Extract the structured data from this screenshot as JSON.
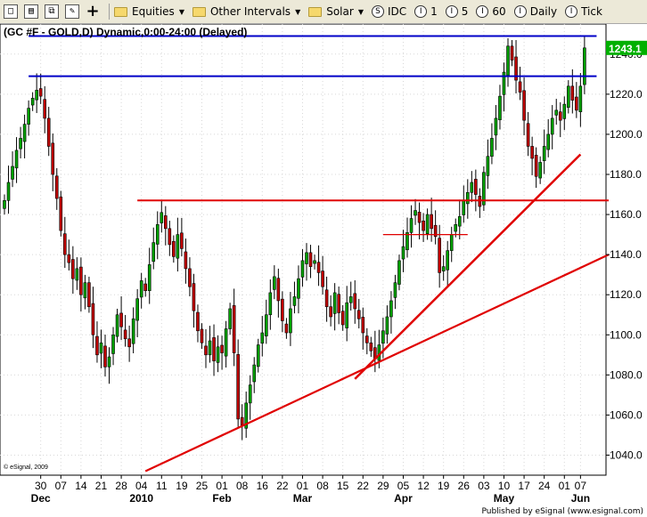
{
  "toolbar": {
    "items": [
      {
        "label": "Equities"
      },
      {
        "label": "Other Intervals"
      },
      {
        "label": "Solar"
      },
      {
        "glyph": "S",
        "label": "IDC"
      },
      {
        "glyph": "I",
        "label": "1"
      },
      {
        "glyph": "I",
        "label": "5"
      },
      {
        "glyph": "I",
        "label": "60"
      },
      {
        "glyph": "I",
        "label": "Daily"
      },
      {
        "glyph": "I",
        "label": "Tick"
      }
    ]
  },
  "copyright": "© eSignal, 2009",
  "footer": "Published by eSignal (www.esignal.com)",
  "colors": {
    "up": "#00a000",
    "down": "#c00000",
    "support": "#e00000",
    "resistance": "#0000c8",
    "price_tag": "#00b000"
  },
  "chart_data": {
    "type": "candlestick",
    "title": "(GC #F - GOLD,D) Dynamic,0:00-24:00 (Delayed)",
    "ylim": [
      1030,
      1255
    ],
    "y_ticks": [
      1040,
      1060,
      1080,
      1100,
      1120,
      1140,
      1160,
      1180,
      1200,
      1220,
      1240
    ],
    "last_price": "1243.1",
    "x_ticks": [
      {
        "i": 9,
        "label": "30"
      },
      {
        "i": 14,
        "label": "07"
      },
      {
        "i": 19,
        "label": "14"
      },
      {
        "i": 24,
        "label": "21"
      },
      {
        "i": 29,
        "label": "28"
      },
      {
        "i": 34,
        "label": "04"
      },
      {
        "i": 39,
        "label": "11"
      },
      {
        "i": 44,
        "label": "19"
      },
      {
        "i": 49,
        "label": "25"
      },
      {
        "i": 54,
        "label": "01"
      },
      {
        "i": 59,
        "label": "08"
      },
      {
        "i": 64,
        "label": "16"
      },
      {
        "i": 69,
        "label": "22"
      },
      {
        "i": 74,
        "label": "01"
      },
      {
        "i": 79,
        "label": "08"
      },
      {
        "i": 84,
        "label": "15"
      },
      {
        "i": 89,
        "label": "22"
      },
      {
        "i": 94,
        "label": "29"
      },
      {
        "i": 99,
        "label": "05"
      },
      {
        "i": 104,
        "label": "12"
      },
      {
        "i": 109,
        "label": "19"
      },
      {
        "i": 114,
        "label": "26"
      },
      {
        "i": 119,
        "label": "03"
      },
      {
        "i": 124,
        "label": "10"
      },
      {
        "i": 129,
        "label": "17"
      },
      {
        "i": 134,
        "label": "24"
      },
      {
        "i": 139,
        "label": "01"
      },
      {
        "i": 143,
        "label": "07"
      }
    ],
    "x_months": [
      {
        "i": 9,
        "label": "Dec"
      },
      {
        "i": 34,
        "label": "2010"
      },
      {
        "i": 54,
        "label": "Feb"
      },
      {
        "i": 74,
        "label": "Mar"
      },
      {
        "i": 99,
        "label": "Apr"
      },
      {
        "i": 124,
        "label": "May"
      },
      {
        "i": 143,
        "label": "Jun"
      }
    ],
    "closes": [
      1167,
      1176,
      1184,
      1192,
      1198,
      1205,
      1213,
      1218,
      1222,
      1219,
      1208,
      1194,
      1180,
      1168,
      1152,
      1140,
      1136,
      1128,
      1133,
      1120,
      1126,
      1114,
      1100,
      1090,
      1096,
      1084,
      1089,
      1100,
      1110,
      1104,
      1098,
      1094,
      1108,
      1118,
      1127,
      1122,
      1135,
      1146,
      1155,
      1161,
      1153,
      1145,
      1139,
      1150,
      1143,
      1133,
      1124,
      1112,
      1102,
      1096,
      1090,
      1097,
      1087,
      1094,
      1091,
      1103,
      1113,
      1091,
      1058,
      1055,
      1066,
      1075,
      1085,
      1095,
      1101,
      1110,
      1121,
      1129,
      1117,
      1107,
      1101,
      1113,
      1119,
      1128,
      1137,
      1141,
      1134,
      1137,
      1131,
      1124,
      1114,
      1109,
      1121,
      1111,
      1105,
      1116,
      1119,
      1113,
      1108,
      1101,
      1096,
      1092,
      1088,
      1095,
      1102,
      1109,
      1117,
      1126,
      1137,
      1144,
      1151,
      1158,
      1162,
      1156,
      1152,
      1160,
      1153,
      1149,
      1131,
      1134,
      1142,
      1150,
      1155,
      1159,
      1167,
      1171,
      1176,
      1170,
      1164,
      1181,
      1189,
      1198,
      1208,
      1219,
      1231,
      1244,
      1237,
      1227,
      1221,
      1207,
      1194,
      1188,
      1179,
      1186,
      1194,
      1200,
      1208,
      1212,
      1207,
      1215,
      1224,
      1217,
      1212,
      1224,
      1243.1
    ]
  }
}
